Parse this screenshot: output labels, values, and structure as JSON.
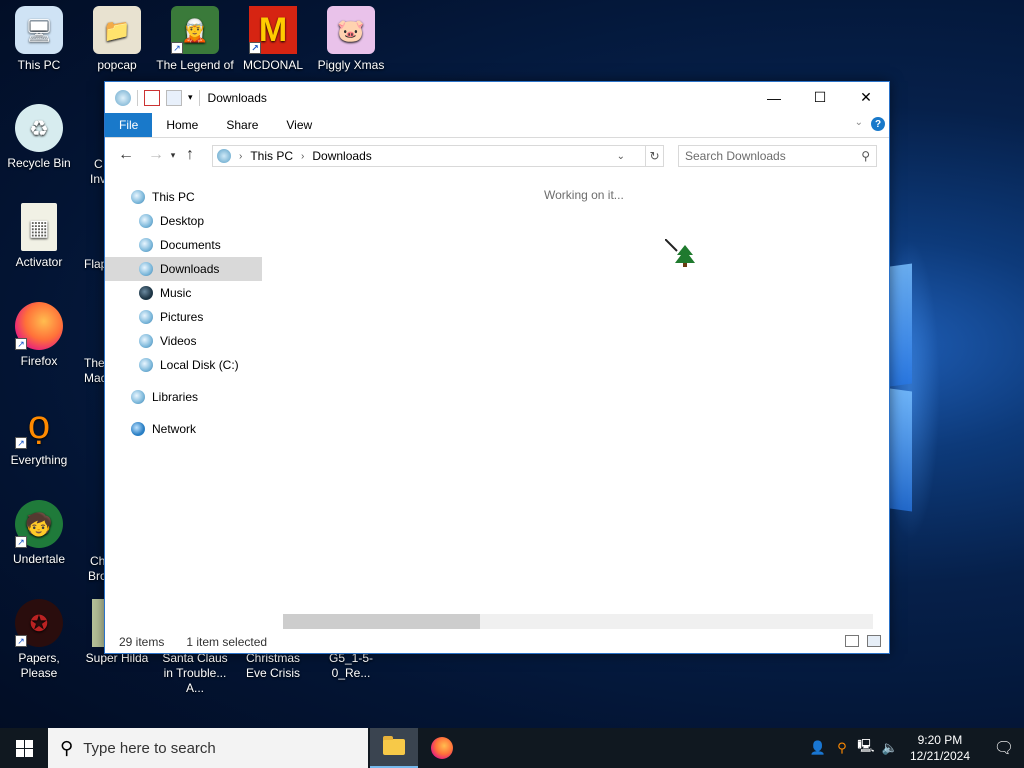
{
  "desktop": {
    "icons": [
      {
        "label": "This PC",
        "icon": "computer-icon"
      },
      {
        "label": "popcap",
        "icon": "folder-icon"
      },
      {
        "label": "The Legend of Zilda",
        "icon": "game-icon"
      },
      {
        "label": "MCDONAL TREASURE",
        "icon": "game-icon"
      },
      {
        "label": "Piggly Xmas",
        "icon": "game-icon"
      },
      {
        "label": "Recycle Bin",
        "icon": "recycle-bin-icon"
      },
      {
        "label": "Activator",
        "icon": "file-icon"
      },
      {
        "label": "Firefox",
        "icon": "firefox-icon"
      },
      {
        "label": "Everything",
        "icon": "search-app-icon"
      },
      {
        "label": "Undertale",
        "icon": "game-icon"
      },
      {
        "label": "Papers, Please",
        "icon": "game-icon"
      },
      {
        "label": "Super Hilda",
        "icon": "game-icon"
      },
      {
        "label": "Santa Claus in Trouble... A...",
        "icon": "game-icon"
      },
      {
        "label": "Christmas Eve Crisis",
        "icon": "game-icon"
      },
      {
        "label": "G5_1-5-0_Re...",
        "icon": "file-icon"
      }
    ],
    "partial_labels": [
      "C",
      "Inv",
      "Flap",
      "The",
      "Mac",
      "Ch",
      "Bro"
    ]
  },
  "window": {
    "title": "Downloads",
    "ribbon_tabs": [
      "File",
      "Home",
      "Share",
      "View"
    ],
    "address": {
      "crumbs": [
        "This PC",
        "Downloads"
      ]
    },
    "search_placeholder": "Search Downloads",
    "nav_items": [
      {
        "label": "This PC",
        "indent": false,
        "selected": false
      },
      {
        "label": "Desktop",
        "indent": true,
        "selected": false
      },
      {
        "label": "Documents",
        "indent": true,
        "selected": false
      },
      {
        "label": "Downloads",
        "indent": true,
        "selected": true
      },
      {
        "label": "Music",
        "indent": true,
        "selected": false
      },
      {
        "label": "Pictures",
        "indent": true,
        "selected": false
      },
      {
        "label": "Videos",
        "indent": true,
        "selected": false
      },
      {
        "label": "Local Disk (C:)",
        "indent": true,
        "selected": false
      },
      {
        "label": "Libraries",
        "indent": false,
        "selected": false
      },
      {
        "label": "Network",
        "indent": false,
        "selected": false
      }
    ],
    "content_message": "Working on it...",
    "status": {
      "items": "29 items",
      "selected": "1 item selected"
    }
  },
  "taskbar": {
    "search_placeholder": "Type here to search",
    "time": "9:20 PM",
    "date": "12/21/2024"
  }
}
